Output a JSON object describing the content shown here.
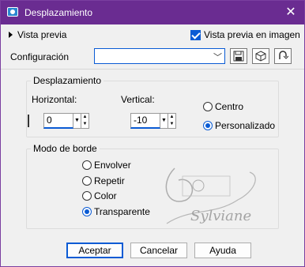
{
  "window": {
    "title": "Desplazamiento",
    "close_glyph": "✕"
  },
  "preview": {
    "label": "Vista previa",
    "image_label": "Vista previa en imagen",
    "image_checked": true
  },
  "config": {
    "label": "Configuración",
    "value": "",
    "buttons": [
      "save-icon",
      "presets-icon",
      "reset-icon"
    ]
  },
  "offset": {
    "group_title": "Desplazamiento",
    "horizontal": {
      "label": "Horizontal:",
      "value": "0"
    },
    "vertical": {
      "label": "Vertical:",
      "value": "-10"
    },
    "link_checked": false,
    "options": [
      {
        "label": "Centro",
        "checked": false
      },
      {
        "label": "Personalizado",
        "checked": true
      }
    ]
  },
  "border_mode": {
    "group_title": "Modo de borde",
    "options": [
      {
        "label": "Envolver",
        "checked": false
      },
      {
        "label": "Repetir",
        "checked": false
      },
      {
        "label": "Color",
        "checked": false
      },
      {
        "label": "Transparente",
        "checked": true
      }
    ]
  },
  "watermark": {
    "text": "Sylviane"
  },
  "buttons": {
    "accept": "Aceptar",
    "cancel": "Cancelar",
    "help": "Ayuda"
  },
  "colors": {
    "titlebar": "#6a2c91",
    "accent": "#0a5bd4"
  }
}
